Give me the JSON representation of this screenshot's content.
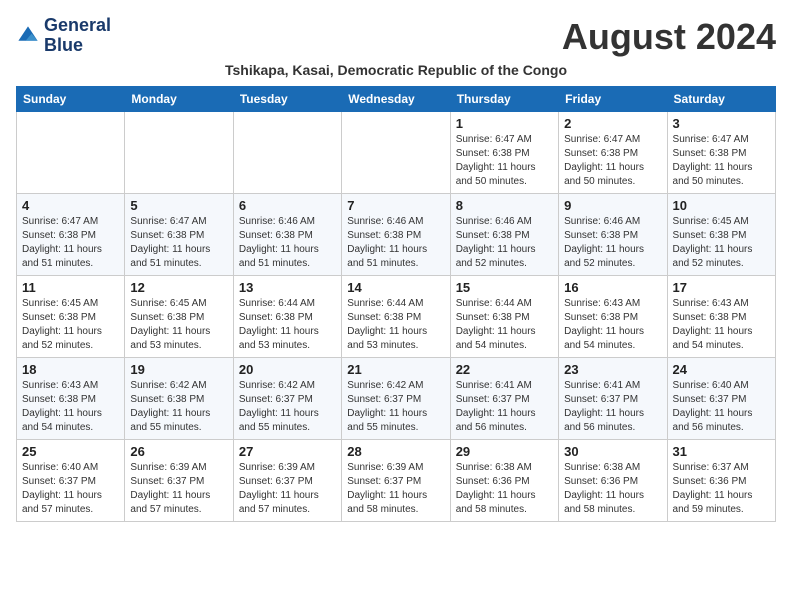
{
  "header": {
    "logo_line1": "General",
    "logo_line2": "Blue",
    "month_title": "August 2024",
    "subtitle": "Tshikapa, Kasai, Democratic Republic of the Congo"
  },
  "weekdays": [
    "Sunday",
    "Monday",
    "Tuesday",
    "Wednesday",
    "Thursday",
    "Friday",
    "Saturday"
  ],
  "weeks": [
    [
      {
        "day": "",
        "info": ""
      },
      {
        "day": "",
        "info": ""
      },
      {
        "day": "",
        "info": ""
      },
      {
        "day": "",
        "info": ""
      },
      {
        "day": "1",
        "info": "Sunrise: 6:47 AM\nSunset: 6:38 PM\nDaylight: 11 hours\nand 50 minutes."
      },
      {
        "day": "2",
        "info": "Sunrise: 6:47 AM\nSunset: 6:38 PM\nDaylight: 11 hours\nand 50 minutes."
      },
      {
        "day": "3",
        "info": "Sunrise: 6:47 AM\nSunset: 6:38 PM\nDaylight: 11 hours\nand 50 minutes."
      }
    ],
    [
      {
        "day": "4",
        "info": "Sunrise: 6:47 AM\nSunset: 6:38 PM\nDaylight: 11 hours\nand 51 minutes."
      },
      {
        "day": "5",
        "info": "Sunrise: 6:47 AM\nSunset: 6:38 PM\nDaylight: 11 hours\nand 51 minutes."
      },
      {
        "day": "6",
        "info": "Sunrise: 6:46 AM\nSunset: 6:38 PM\nDaylight: 11 hours\nand 51 minutes."
      },
      {
        "day": "7",
        "info": "Sunrise: 6:46 AM\nSunset: 6:38 PM\nDaylight: 11 hours\nand 51 minutes."
      },
      {
        "day": "8",
        "info": "Sunrise: 6:46 AM\nSunset: 6:38 PM\nDaylight: 11 hours\nand 52 minutes."
      },
      {
        "day": "9",
        "info": "Sunrise: 6:46 AM\nSunset: 6:38 PM\nDaylight: 11 hours\nand 52 minutes."
      },
      {
        "day": "10",
        "info": "Sunrise: 6:45 AM\nSunset: 6:38 PM\nDaylight: 11 hours\nand 52 minutes."
      }
    ],
    [
      {
        "day": "11",
        "info": "Sunrise: 6:45 AM\nSunset: 6:38 PM\nDaylight: 11 hours\nand 52 minutes."
      },
      {
        "day": "12",
        "info": "Sunrise: 6:45 AM\nSunset: 6:38 PM\nDaylight: 11 hours\nand 53 minutes."
      },
      {
        "day": "13",
        "info": "Sunrise: 6:44 AM\nSunset: 6:38 PM\nDaylight: 11 hours\nand 53 minutes."
      },
      {
        "day": "14",
        "info": "Sunrise: 6:44 AM\nSunset: 6:38 PM\nDaylight: 11 hours\nand 53 minutes."
      },
      {
        "day": "15",
        "info": "Sunrise: 6:44 AM\nSunset: 6:38 PM\nDaylight: 11 hours\nand 54 minutes."
      },
      {
        "day": "16",
        "info": "Sunrise: 6:43 AM\nSunset: 6:38 PM\nDaylight: 11 hours\nand 54 minutes."
      },
      {
        "day": "17",
        "info": "Sunrise: 6:43 AM\nSunset: 6:38 PM\nDaylight: 11 hours\nand 54 minutes."
      }
    ],
    [
      {
        "day": "18",
        "info": "Sunrise: 6:43 AM\nSunset: 6:38 PM\nDaylight: 11 hours\nand 54 minutes."
      },
      {
        "day": "19",
        "info": "Sunrise: 6:42 AM\nSunset: 6:38 PM\nDaylight: 11 hours\nand 55 minutes."
      },
      {
        "day": "20",
        "info": "Sunrise: 6:42 AM\nSunset: 6:37 PM\nDaylight: 11 hours\nand 55 minutes."
      },
      {
        "day": "21",
        "info": "Sunrise: 6:42 AM\nSunset: 6:37 PM\nDaylight: 11 hours\nand 55 minutes."
      },
      {
        "day": "22",
        "info": "Sunrise: 6:41 AM\nSunset: 6:37 PM\nDaylight: 11 hours\nand 56 minutes."
      },
      {
        "day": "23",
        "info": "Sunrise: 6:41 AM\nSunset: 6:37 PM\nDaylight: 11 hours\nand 56 minutes."
      },
      {
        "day": "24",
        "info": "Sunrise: 6:40 AM\nSunset: 6:37 PM\nDaylight: 11 hours\nand 56 minutes."
      }
    ],
    [
      {
        "day": "25",
        "info": "Sunrise: 6:40 AM\nSunset: 6:37 PM\nDaylight: 11 hours\nand 57 minutes."
      },
      {
        "day": "26",
        "info": "Sunrise: 6:39 AM\nSunset: 6:37 PM\nDaylight: 11 hours\nand 57 minutes."
      },
      {
        "day": "27",
        "info": "Sunrise: 6:39 AM\nSunset: 6:37 PM\nDaylight: 11 hours\nand 57 minutes."
      },
      {
        "day": "28",
        "info": "Sunrise: 6:39 AM\nSunset: 6:37 PM\nDaylight: 11 hours\nand 58 minutes."
      },
      {
        "day": "29",
        "info": "Sunrise: 6:38 AM\nSunset: 6:36 PM\nDaylight: 11 hours\nand 58 minutes."
      },
      {
        "day": "30",
        "info": "Sunrise: 6:38 AM\nSunset: 6:36 PM\nDaylight: 11 hours\nand 58 minutes."
      },
      {
        "day": "31",
        "info": "Sunrise: 6:37 AM\nSunset: 6:36 PM\nDaylight: 11 hours\nand 59 minutes."
      }
    ]
  ]
}
